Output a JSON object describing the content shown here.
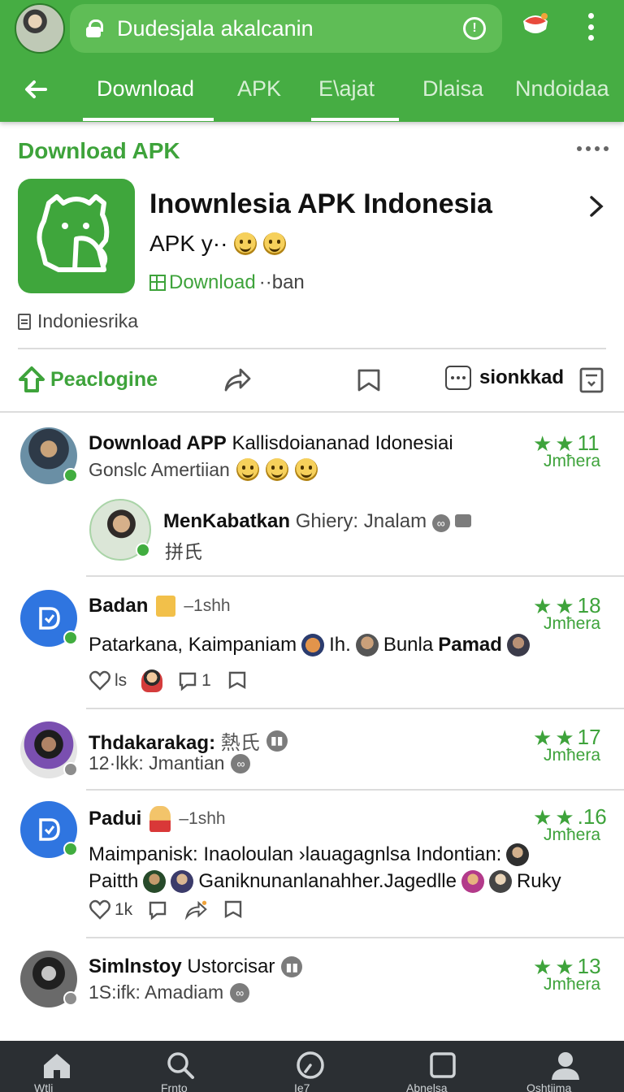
{
  "browser": {
    "url": "Dudesjala akalcanin"
  },
  "tabs": [
    "Download",
    "APK",
    "E\\ajat",
    "Dlaisa",
    "Nndoidaa"
  ],
  "app": {
    "section_title": "Download APK",
    "title": "Inownlesia APK Indonesia",
    "subtitle": "APK y··",
    "download_label": "Download",
    "download_suffix": "··ban",
    "region": "Indoniesrika"
  },
  "actions": {
    "primary": "Peaclogine",
    "more_label": "sionkkad"
  },
  "posts": [
    {
      "name_bold": "Download APP",
      "name_rest": " Kallisdoiananad Idonesiai",
      "sub": "Gonslc Amertiian",
      "stars": "11",
      "rating_label": "Jmħera",
      "reply": {
        "name_bold": "MenKabatkan",
        "name_rest": " Ghiery: Jnalam",
        "sub": "拼氏"
      }
    },
    {
      "name_bold": "Badan",
      "time": "–1shh",
      "stars": "18",
      "rating_label": "Jmħera",
      "text_a": "Patarkana, Kaimpaniam",
      "text_b": "Ih.",
      "text_c": "Bunla",
      "text_d": "Pamad",
      "likes": "ls",
      "replies": "1"
    },
    {
      "name_bold": "Thdakarakag:",
      "name_rest": " 熱氏",
      "sub": "12·lkk: Jmantian",
      "stars": "17",
      "rating_label": "Jmħera"
    },
    {
      "name_bold": "Padui",
      "time": "–1shh",
      "stars": ".16",
      "rating_label": "Jmħera",
      "line1": "Maimpanisk: Inaoloulan ›lauagagnlsa Indontian:",
      "line2a": "Paitth",
      "line2b": "Ganiknunanlanahher.Jagedlle",
      "line2c": "Ruky",
      "likes": "1k"
    },
    {
      "name_bold": "Simlnstoy",
      "name_rest": " Ustorcisar",
      "sub": "1S:ifk: Amadiam",
      "stars": "13",
      "rating_label": "Jmħera"
    }
  ],
  "bottom_nav": [
    "Wtli",
    "Frnto",
    "Ie7",
    "Abnelsa",
    "Oshtiima"
  ],
  "colors": {
    "brand_green": "#46ad43",
    "accent_green": "#3ea33b",
    "nav_dark": "#2b2f33",
    "avatar_blue": "#2f75e0"
  },
  "icons": [
    "lock-icon",
    "info-icon",
    "extension-icon",
    "menu-icon",
    "back-arrow-icon",
    "more-dots-icon",
    "chevron-right-icon",
    "home-upload-icon",
    "share-icon",
    "bookmark-icon",
    "dots-box-icon",
    "save-icon",
    "heart-icon",
    "comment-icon",
    "repost-icon",
    "home-icon",
    "search-icon",
    "clock-icon",
    "square-icon",
    "profile-icon"
  ]
}
